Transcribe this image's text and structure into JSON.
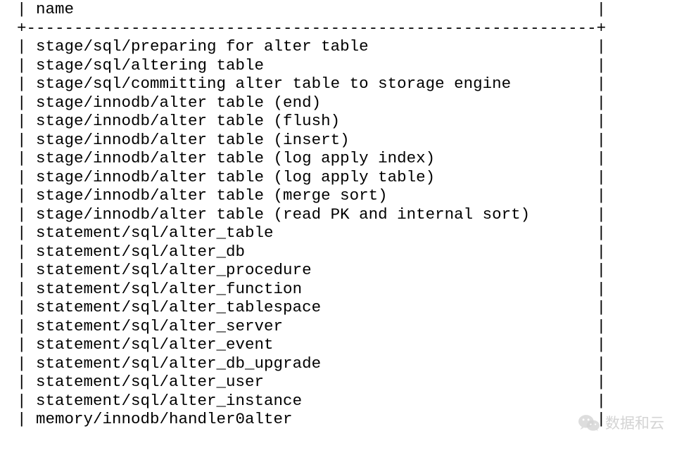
{
  "table": {
    "column_header": "name",
    "divider": "--------------------------------------------------------",
    "rows": [
      "stage/sql/preparing for alter table",
      "stage/sql/altering table",
      "stage/sql/committing alter table to storage engine",
      "stage/innodb/alter table (end)",
      "stage/innodb/alter table (flush)",
      "stage/innodb/alter table (insert)",
      "stage/innodb/alter table (log apply index)",
      "stage/innodb/alter table (log apply table)",
      "stage/innodb/alter table (merge sort)",
      "stage/innodb/alter table (read PK and internal sort)",
      "statement/sql/alter_table",
      "statement/sql/alter_db",
      "statement/sql/alter_procedure",
      "statement/sql/alter_function",
      "statement/sql/alter_tablespace",
      "statement/sql/alter_server",
      "statement/sql/alter_event",
      "statement/sql/alter_db_upgrade",
      "statement/sql/alter_user",
      "statement/sql/alter_instance",
      "memory/innodb/handler0alter"
    ]
  },
  "watermark": {
    "text": "数据和云"
  }
}
